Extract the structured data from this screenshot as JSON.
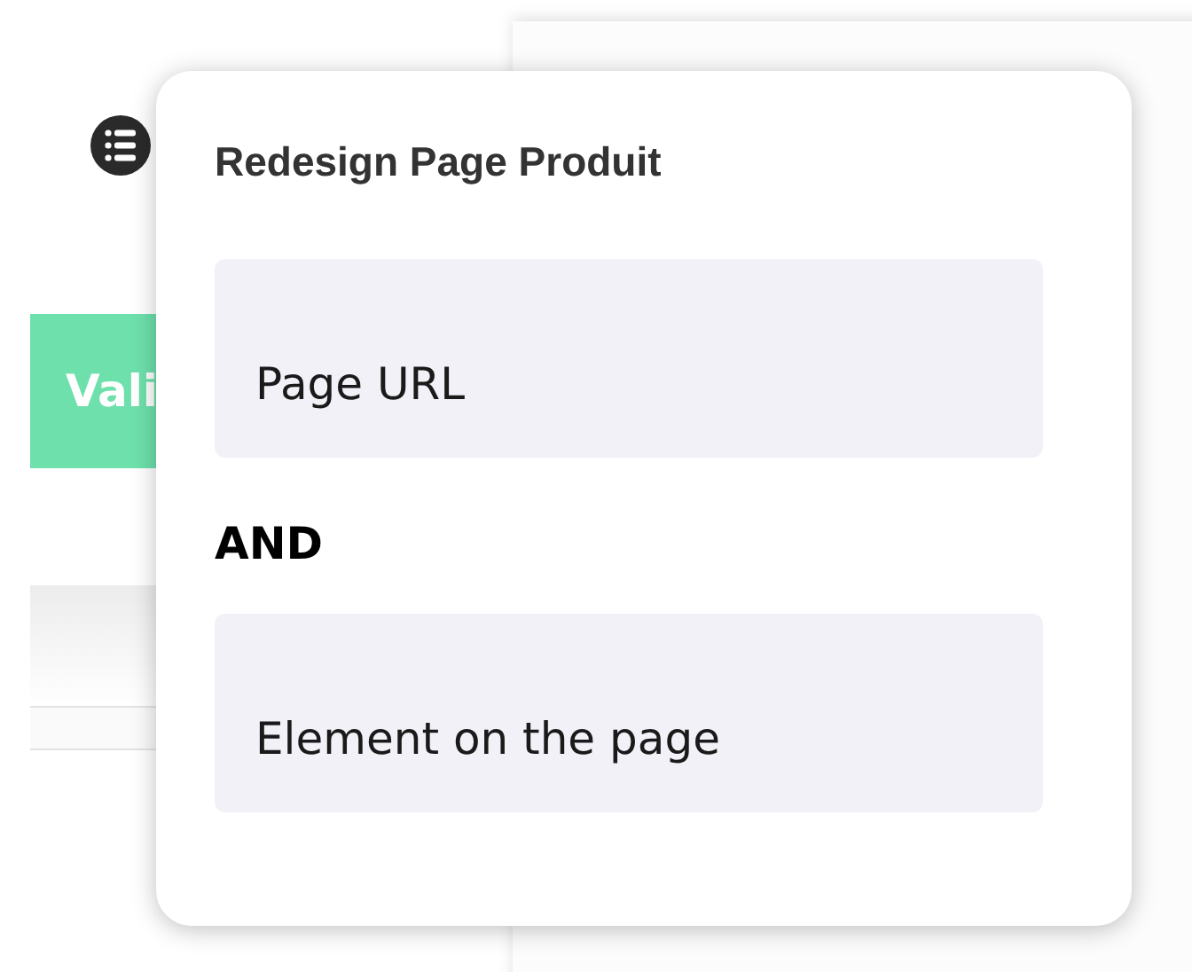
{
  "background": {
    "button": {
      "label": "Vali"
    }
  },
  "popup": {
    "title": "Redesign Page Produit",
    "conditions": [
      {
        "kind": "field",
        "value": "Page URL"
      },
      {
        "kind": "operator",
        "label": "AND"
      },
      {
        "kind": "field",
        "value": "Element on the page"
      }
    ]
  }
}
